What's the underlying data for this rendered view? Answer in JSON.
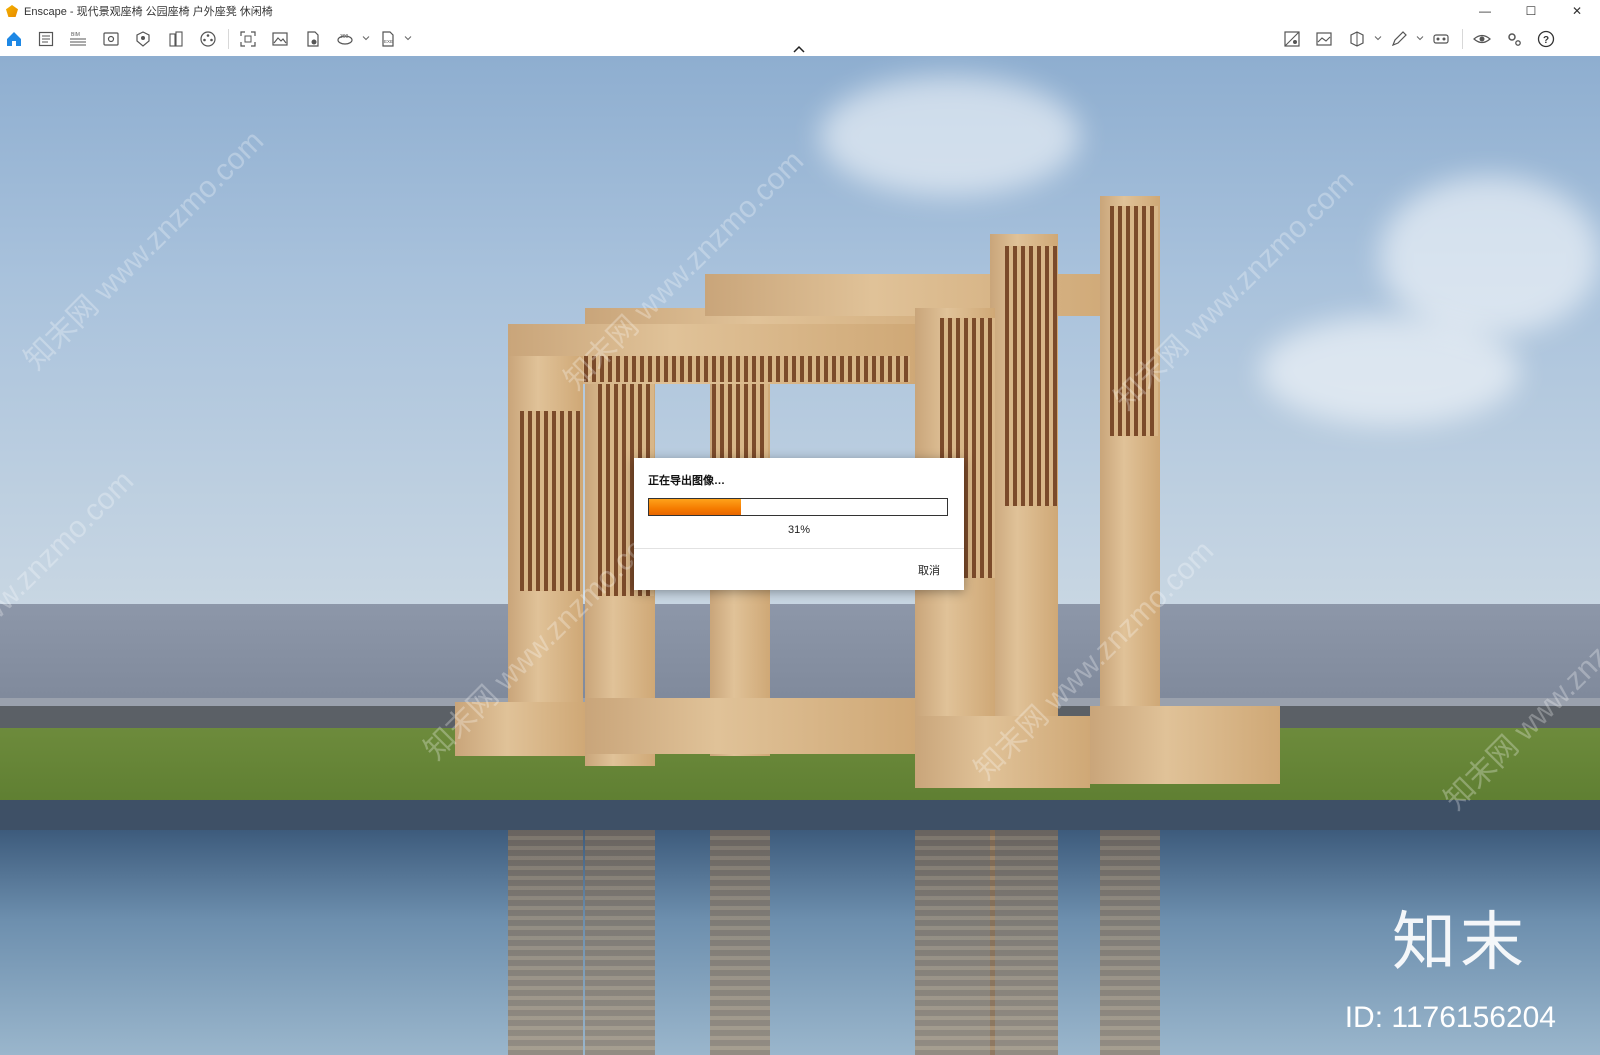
{
  "window": {
    "title": "Enscape - 现代景观座椅 公园座椅 户外座凳 休闲椅",
    "minimize": "—",
    "maximize": "☐",
    "close": "✕"
  },
  "toolbar": {
    "left_icons": [
      "home-icon",
      "notes-icon",
      "bim-icon",
      "view-icon",
      "asset-library-icon",
      "building-icon",
      "video-editor-icon",
      "screenshot-icon",
      "render-image-icon",
      "batch-render-icon",
      "panorama-360-icon",
      "export-exe-icon"
    ],
    "right_icons": [
      "visual-settings-icon",
      "atmosphere-icon",
      "material-editor-icon",
      "pencil-editor-icon",
      "vr-headset-icon",
      "view-eye-icon",
      "settings-gear-icon",
      "help-icon"
    ],
    "help_label": "?"
  },
  "dialog": {
    "title": "正在导出图像…",
    "progress": 0.31,
    "progress_text": "31%",
    "cancel_label": "取消"
  },
  "watermark": {
    "site": "知末网 www.znzmo.com",
    "brand": "知末",
    "id_text": "ID: 1176156204"
  },
  "colors": {
    "progress_orange": "#f57b00",
    "home_icon_blue": "#1e88e5"
  }
}
